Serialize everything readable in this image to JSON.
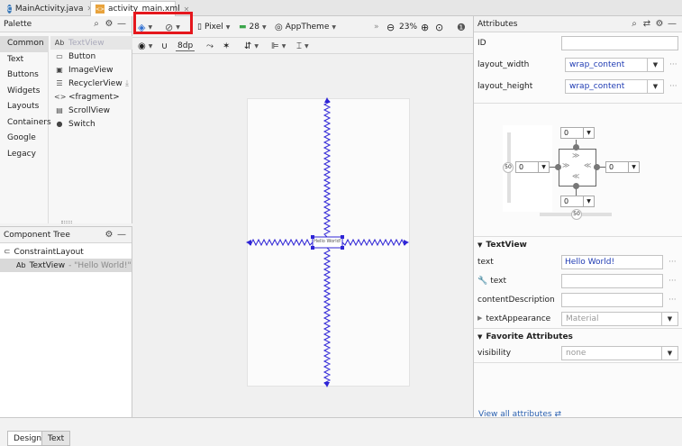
{
  "editor_tabs": [
    {
      "label": "MainActivity.java",
      "active": false
    },
    {
      "label": "activity_main.xml",
      "active": true
    }
  ],
  "palette": {
    "title": "Palette",
    "categories": [
      "Common",
      "Text",
      "Buttons",
      "Widgets",
      "Layouts",
      "Containers",
      "Google",
      "Legacy"
    ],
    "selected_category": "Common",
    "widgets": [
      {
        "glyph": "Ab",
        "label": "TextView"
      },
      {
        "glyph": "▭",
        "label": "Button"
      },
      {
        "glyph": "▣",
        "label": "ImageView"
      },
      {
        "glyph": "☰",
        "label": "RecyclerView"
      },
      {
        "glyph": "<>",
        "label": "<fragment>"
      },
      {
        "glyph": "▤",
        "label": "ScrollView"
      },
      {
        "glyph": "●",
        "label": "Switch"
      }
    ]
  },
  "component_tree": {
    "title": "Component Tree",
    "root": "ConstraintLayout",
    "child_glyph": "Ab",
    "child_name": "TextView",
    "child_value": "- \"Hello World!\""
  },
  "toolbar": {
    "device": "Pixel",
    "api": "28",
    "theme": "AppTheme",
    "zoom": "23%",
    "margin": "8dp"
  },
  "canvas": {
    "widget_text": "Hello World!",
    "accent": "#2f25d6"
  },
  "attributes": {
    "title": "Attributes",
    "id_label": "ID",
    "id_value": "",
    "layout_width_label": "layout_width",
    "layout_width_value": "wrap_content",
    "layout_height_label": "layout_height",
    "layout_height_value": "wrap_content",
    "constraint": {
      "top": "0",
      "bottom": "0",
      "left": "0",
      "right": "0",
      "vbias": "50",
      "hbias": "50"
    },
    "textview_section": "TextView",
    "text_label": "text",
    "text_value": "Hello World!",
    "tools_text_label": "text",
    "tools_text_value": "",
    "content_description_label": "contentDescription",
    "text_appearance_label": "textAppearance",
    "text_appearance_value": "Material",
    "favorite_section": "Favorite Attributes",
    "visibility_label": "visibility",
    "visibility_value": "none",
    "view_all": "View all attributes"
  },
  "bottom_tabs": [
    {
      "label": "Design",
      "active": true
    },
    {
      "label": "Text",
      "active": false
    }
  ]
}
